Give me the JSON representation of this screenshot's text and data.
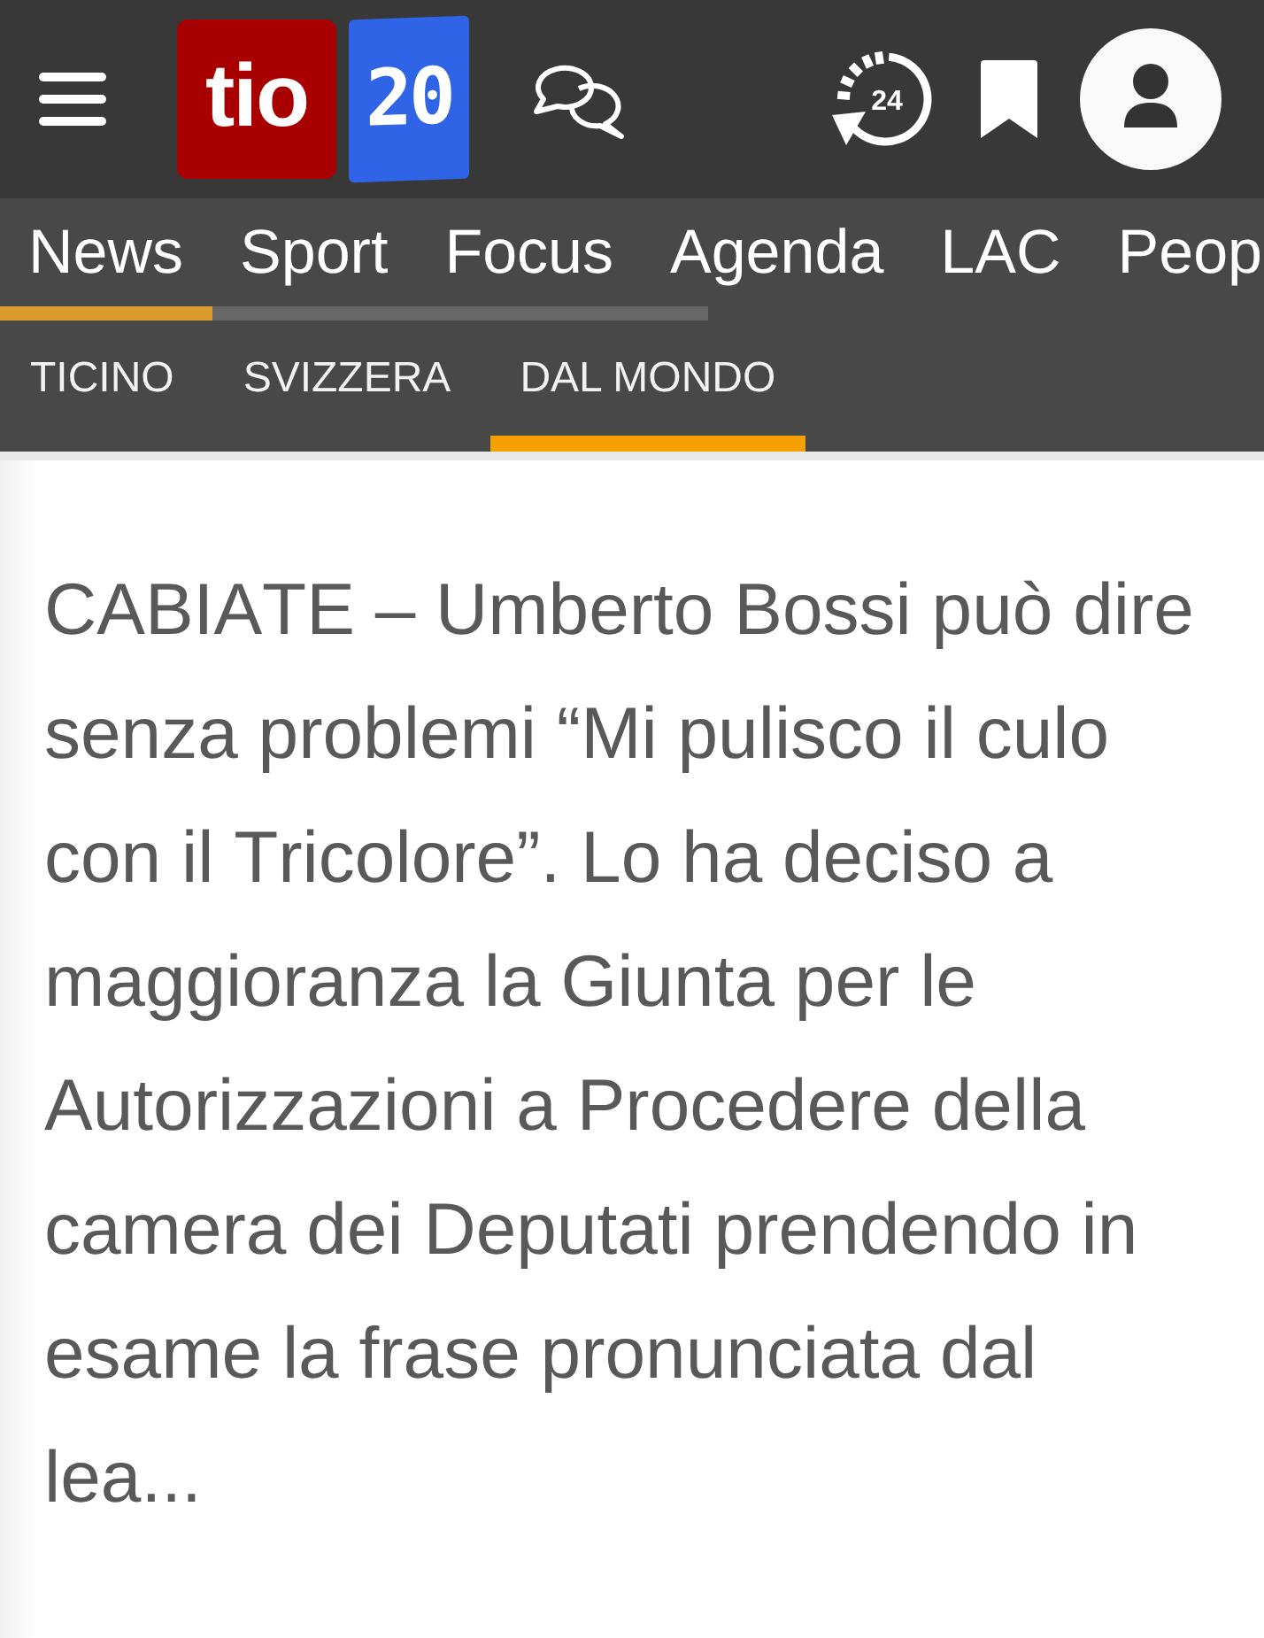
{
  "header": {
    "logo": {
      "word": "tio",
      "digits": "20"
    },
    "recent_badge": "24"
  },
  "main_tabs": [
    {
      "label": "News",
      "selected": true
    },
    {
      "label": "Sport",
      "selected": false
    },
    {
      "label": "Focus",
      "selected": false
    },
    {
      "label": "Agenda",
      "selected": false
    },
    {
      "label": "LAC",
      "selected": false
    },
    {
      "label": "Peop",
      "selected": false
    }
  ],
  "sub_tabs": [
    {
      "label": "TICINO",
      "selected": false
    },
    {
      "label": "SVIZZERA",
      "selected": false
    },
    {
      "label": "DAL MONDO",
      "selected": true
    }
  ],
  "article": {
    "text": "CABIATE – Umberto Bossi può dire senza problemi “Mi pulisco il culo con il Tricolore”. Lo ha deciso a maggioranza la Giunta per le Autorizzazioni a Procedere della camera dei Deputati prendendo in esame la frase pronunciata dal lea..."
  }
}
